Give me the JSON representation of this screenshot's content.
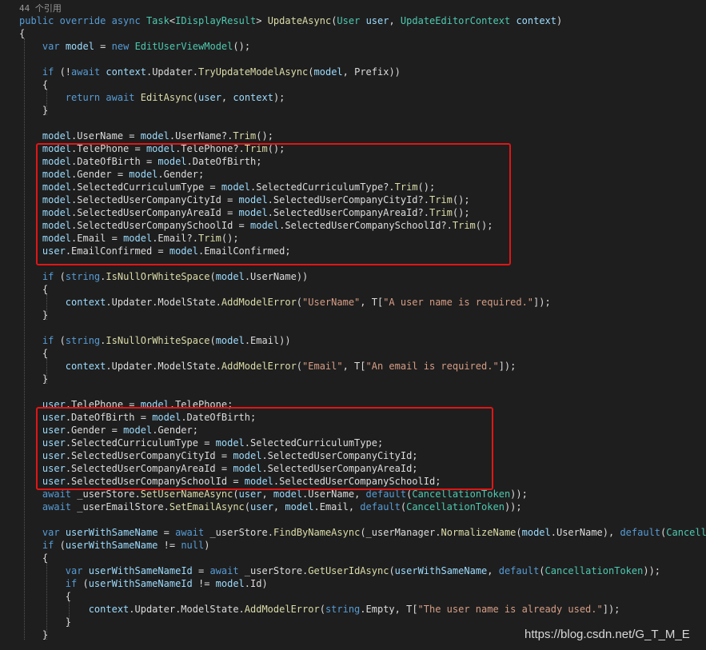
{
  "codelens": "44 个引用",
  "lines": [
    [
      [
        "public override async ",
        "kw"
      ],
      [
        "Task",
        "typ"
      ],
      [
        "<",
        "pln"
      ],
      [
        "IDisplayResult",
        "typ"
      ],
      [
        "> ",
        "pln"
      ],
      [
        "UpdateAsync",
        "mth"
      ],
      [
        "(",
        "pln"
      ],
      [
        "User",
        "typ"
      ],
      [
        " ",
        "pln"
      ],
      [
        "user",
        "var"
      ],
      [
        ", ",
        "pln"
      ],
      [
        "UpdateEditorContext",
        "typ"
      ],
      [
        " ",
        "pln"
      ],
      [
        "context",
        "var"
      ],
      [
        ")",
        "pln"
      ]
    ],
    [
      [
        "{",
        "pln"
      ]
    ],
    [
      [
        "    ",
        "pln"
      ],
      [
        "var",
        "kw"
      ],
      [
        " ",
        "pln"
      ],
      [
        "model",
        "var"
      ],
      [
        " = ",
        "pln"
      ],
      [
        "new",
        "kw"
      ],
      [
        " ",
        "pln"
      ],
      [
        "EditUserViewModel",
        "typ"
      ],
      [
        "();",
        "pln"
      ]
    ],
    [],
    [
      [
        "    ",
        "pln"
      ],
      [
        "if",
        "kw"
      ],
      [
        " (!",
        "pln"
      ],
      [
        "await",
        "kw"
      ],
      [
        " ",
        "pln"
      ],
      [
        "context",
        "var"
      ],
      [
        ".Updater.",
        "pln"
      ],
      [
        "TryUpdateModelAsync",
        "mth"
      ],
      [
        "(",
        "pln"
      ],
      [
        "model",
        "var"
      ],
      [
        ", Prefix))",
        "pln"
      ]
    ],
    [
      [
        "    {",
        "pln"
      ]
    ],
    [
      [
        "        ",
        "pln"
      ],
      [
        "return",
        "kw"
      ],
      [
        " ",
        "pln"
      ],
      [
        "await",
        "kw"
      ],
      [
        " ",
        "pln"
      ],
      [
        "EditAsync",
        "mth"
      ],
      [
        "(",
        "pln"
      ],
      [
        "user",
        "var"
      ],
      [
        ", ",
        "pln"
      ],
      [
        "context",
        "var"
      ],
      [
        ");",
        "pln"
      ]
    ],
    [
      [
        "    }",
        "pln"
      ]
    ],
    [],
    [
      [
        "    ",
        "pln"
      ],
      [
        "model",
        "var"
      ],
      [
        ".UserName = ",
        "pln"
      ],
      [
        "model",
        "var"
      ],
      [
        ".UserName?.",
        "pln"
      ],
      [
        "Trim",
        "mth"
      ],
      [
        "();",
        "pln"
      ]
    ],
    [
      [
        "    ",
        "pln"
      ],
      [
        "model",
        "var"
      ],
      [
        ".TelePhone = ",
        "pln"
      ],
      [
        "model",
        "var"
      ],
      [
        ".TelePhone?.",
        "pln"
      ],
      [
        "Trim",
        "mth"
      ],
      [
        "();",
        "pln"
      ]
    ],
    [
      [
        "    ",
        "pln"
      ],
      [
        "model",
        "var"
      ],
      [
        ".DateOfBirth = ",
        "pln"
      ],
      [
        "model",
        "var"
      ],
      [
        ".DateOfBirth;",
        "pln"
      ]
    ],
    [
      [
        "    ",
        "pln"
      ],
      [
        "model",
        "var"
      ],
      [
        ".Gender = ",
        "pln"
      ],
      [
        "model",
        "var"
      ],
      [
        ".Gender;",
        "pln"
      ]
    ],
    [
      [
        "    ",
        "pln"
      ],
      [
        "model",
        "var"
      ],
      [
        ".SelectedCurriculumType = ",
        "pln"
      ],
      [
        "model",
        "var"
      ],
      [
        ".SelectedCurriculumType?.",
        "pln"
      ],
      [
        "Trim",
        "mth"
      ],
      [
        "();",
        "pln"
      ]
    ],
    [
      [
        "    ",
        "pln"
      ],
      [
        "model",
        "var"
      ],
      [
        ".SelectedUserCompanyCityId = ",
        "pln"
      ],
      [
        "model",
        "var"
      ],
      [
        ".SelectedUserCompanyCityId?.",
        "pln"
      ],
      [
        "Trim",
        "mth"
      ],
      [
        "();",
        "pln"
      ]
    ],
    [
      [
        "    ",
        "pln"
      ],
      [
        "model",
        "var"
      ],
      [
        ".SelectedUserCompanyAreaId = ",
        "pln"
      ],
      [
        "model",
        "var"
      ],
      [
        ".SelectedUserCompanyAreaId?.",
        "pln"
      ],
      [
        "Trim",
        "mth"
      ],
      [
        "();",
        "pln"
      ]
    ],
    [
      [
        "    ",
        "pln"
      ],
      [
        "model",
        "var"
      ],
      [
        ".SelectedUserCompanySchoolId = ",
        "pln"
      ],
      [
        "model",
        "var"
      ],
      [
        ".SelectedUserCompanySchoolId?.",
        "pln"
      ],
      [
        "Trim",
        "mth"
      ],
      [
        "();",
        "pln"
      ]
    ],
    [
      [
        "    ",
        "pln"
      ],
      [
        "model",
        "var"
      ],
      [
        ".Email = ",
        "pln"
      ],
      [
        "model",
        "var"
      ],
      [
        ".Email?.",
        "pln"
      ],
      [
        "Trim",
        "mth"
      ],
      [
        "();",
        "pln"
      ]
    ],
    [
      [
        "    ",
        "pln"
      ],
      [
        "user",
        "var"
      ],
      [
        ".EmailConfirmed = ",
        "pln"
      ],
      [
        "model",
        "var"
      ],
      [
        ".EmailConfirmed;",
        "pln"
      ]
    ],
    [],
    [
      [
        "    ",
        "pln"
      ],
      [
        "if",
        "kw"
      ],
      [
        " (",
        "pln"
      ],
      [
        "string",
        "kw"
      ],
      [
        ".",
        "pln"
      ],
      [
        "IsNullOrWhiteSpace",
        "mth"
      ],
      [
        "(",
        "pln"
      ],
      [
        "model",
        "var"
      ],
      [
        ".UserName))",
        "pln"
      ]
    ],
    [
      [
        "    {",
        "pln"
      ]
    ],
    [
      [
        "        ",
        "pln"
      ],
      [
        "context",
        "var"
      ],
      [
        ".Updater.ModelState.",
        "pln"
      ],
      [
        "AddModelError",
        "mth"
      ],
      [
        "(",
        "pln"
      ],
      [
        "\"UserName\"",
        "str"
      ],
      [
        ", T[",
        "pln"
      ],
      [
        "\"A user name is required.\"",
        "str"
      ],
      [
        "]);",
        "pln"
      ]
    ],
    [
      [
        "    }",
        "pln"
      ]
    ],
    [],
    [
      [
        "    ",
        "pln"
      ],
      [
        "if",
        "kw"
      ],
      [
        " (",
        "pln"
      ],
      [
        "string",
        "kw"
      ],
      [
        ".",
        "pln"
      ],
      [
        "IsNullOrWhiteSpace",
        "mth"
      ],
      [
        "(",
        "pln"
      ],
      [
        "model",
        "var"
      ],
      [
        ".Email))",
        "pln"
      ]
    ],
    [
      [
        "    {",
        "pln"
      ]
    ],
    [
      [
        "        ",
        "pln"
      ],
      [
        "context",
        "var"
      ],
      [
        ".Updater.ModelState.",
        "pln"
      ],
      [
        "AddModelError",
        "mth"
      ],
      [
        "(",
        "pln"
      ],
      [
        "\"Email\"",
        "str"
      ],
      [
        ", T[",
        "pln"
      ],
      [
        "\"An email is required.\"",
        "str"
      ],
      [
        "]);",
        "pln"
      ]
    ],
    [
      [
        "    }",
        "pln"
      ]
    ],
    [],
    [
      [
        "    ",
        "pln"
      ],
      [
        "user",
        "var"
      ],
      [
        ".TelePhone = ",
        "pln"
      ],
      [
        "model",
        "var"
      ],
      [
        ".TelePhone;",
        "pln"
      ]
    ],
    [
      [
        "    ",
        "pln"
      ],
      [
        "user",
        "var"
      ],
      [
        ".DateOfBirth = ",
        "pln"
      ],
      [
        "model",
        "var"
      ],
      [
        ".DateOfBirth;",
        "pln"
      ]
    ],
    [
      [
        "    ",
        "pln"
      ],
      [
        "user",
        "var"
      ],
      [
        ".Gender = ",
        "pln"
      ],
      [
        "model",
        "var"
      ],
      [
        ".Gender;",
        "pln"
      ]
    ],
    [
      [
        "    ",
        "pln"
      ],
      [
        "user",
        "var"
      ],
      [
        ".SelectedCurriculumType = ",
        "pln"
      ],
      [
        "model",
        "var"
      ],
      [
        ".SelectedCurriculumType;",
        "pln"
      ]
    ],
    [
      [
        "    ",
        "pln"
      ],
      [
        "user",
        "var"
      ],
      [
        ".SelectedUserCompanyCityId = ",
        "pln"
      ],
      [
        "model",
        "var"
      ],
      [
        ".SelectedUserCompanyCityId;",
        "pln"
      ]
    ],
    [
      [
        "    ",
        "pln"
      ],
      [
        "user",
        "var"
      ],
      [
        ".SelectedUserCompanyAreaId = ",
        "pln"
      ],
      [
        "model",
        "var"
      ],
      [
        ".SelectedUserCompanyAreaId;",
        "pln"
      ]
    ],
    [
      [
        "    ",
        "pln"
      ],
      [
        "user",
        "var"
      ],
      [
        ".SelectedUserCompanySchoolId = ",
        "pln"
      ],
      [
        "model",
        "var"
      ],
      [
        ".SelectedUserCompanySchoolId;",
        "pln"
      ]
    ],
    [
      [
        "    ",
        "pln"
      ],
      [
        "await",
        "kw"
      ],
      [
        " _userStore.",
        "pln"
      ],
      [
        "SetUserNameAsync",
        "mth"
      ],
      [
        "(",
        "pln"
      ],
      [
        "user",
        "var"
      ],
      [
        ", ",
        "pln"
      ],
      [
        "model",
        "var"
      ],
      [
        ".UserName, ",
        "pln"
      ],
      [
        "default",
        "kw"
      ],
      [
        "(",
        "pln"
      ],
      [
        "CancellationToken",
        "typ"
      ],
      [
        "));",
        "pln"
      ]
    ],
    [
      [
        "    ",
        "pln"
      ],
      [
        "await",
        "kw"
      ],
      [
        " _userEmailStore.",
        "pln"
      ],
      [
        "SetEmailAsync",
        "mth"
      ],
      [
        "(",
        "pln"
      ],
      [
        "user",
        "var"
      ],
      [
        ", ",
        "pln"
      ],
      [
        "model",
        "var"
      ],
      [
        ".Email, ",
        "pln"
      ],
      [
        "default",
        "kw"
      ],
      [
        "(",
        "pln"
      ],
      [
        "CancellationToken",
        "typ"
      ],
      [
        "));",
        "pln"
      ]
    ],
    [],
    [
      [
        "    ",
        "pln"
      ],
      [
        "var",
        "kw"
      ],
      [
        " ",
        "pln"
      ],
      [
        "userWithSameName",
        "var"
      ],
      [
        " = ",
        "pln"
      ],
      [
        "await",
        "kw"
      ],
      [
        " _userStore.",
        "pln"
      ],
      [
        "FindByNameAsync",
        "mth"
      ],
      [
        "(_userManager.",
        "pln"
      ],
      [
        "NormalizeName",
        "mth"
      ],
      [
        "(",
        "pln"
      ],
      [
        "model",
        "var"
      ],
      [
        ".UserName), ",
        "pln"
      ],
      [
        "default",
        "kw"
      ],
      [
        "(",
        "pln"
      ],
      [
        "Cancellatio",
        "typ"
      ]
    ],
    [
      [
        "    ",
        "pln"
      ],
      [
        "if",
        "kw"
      ],
      [
        " (",
        "pln"
      ],
      [
        "userWithSameName",
        "var"
      ],
      [
        " != ",
        "pln"
      ],
      [
        "null",
        "kw"
      ],
      [
        ")",
        "pln"
      ]
    ],
    [
      [
        "    {",
        "pln"
      ]
    ],
    [
      [
        "        ",
        "pln"
      ],
      [
        "var",
        "kw"
      ],
      [
        " ",
        "pln"
      ],
      [
        "userWithSameNameId",
        "var"
      ],
      [
        " = ",
        "pln"
      ],
      [
        "await",
        "kw"
      ],
      [
        " _userStore.",
        "pln"
      ],
      [
        "GetUserIdAsync",
        "mth"
      ],
      [
        "(",
        "pln"
      ],
      [
        "userWithSameName",
        "var"
      ],
      [
        ", ",
        "pln"
      ],
      [
        "default",
        "kw"
      ],
      [
        "(",
        "pln"
      ],
      [
        "CancellationToken",
        "typ"
      ],
      [
        "));",
        "pln"
      ]
    ],
    [
      [
        "        ",
        "pln"
      ],
      [
        "if",
        "kw"
      ],
      [
        " (",
        "pln"
      ],
      [
        "userWithSameNameId",
        "var"
      ],
      [
        " != ",
        "pln"
      ],
      [
        "model",
        "var"
      ],
      [
        ".Id)",
        "pln"
      ]
    ],
    [
      [
        "        {",
        "pln"
      ]
    ],
    [
      [
        "            ",
        "pln"
      ],
      [
        "context",
        "var"
      ],
      [
        ".Updater.ModelState.",
        "pln"
      ],
      [
        "AddModelError",
        "mth"
      ],
      [
        "(",
        "pln"
      ],
      [
        "string",
        "kw"
      ],
      [
        ".Empty, T[",
        "pln"
      ],
      [
        "\"The user name is already used.\"",
        "str"
      ],
      [
        "]);",
        "pln"
      ]
    ],
    [
      [
        "        }",
        "pln"
      ]
    ],
    [
      [
        "    }",
        "pln"
      ]
    ]
  ],
  "watermark": "https://blog.csdn.net/G_T_M_E"
}
